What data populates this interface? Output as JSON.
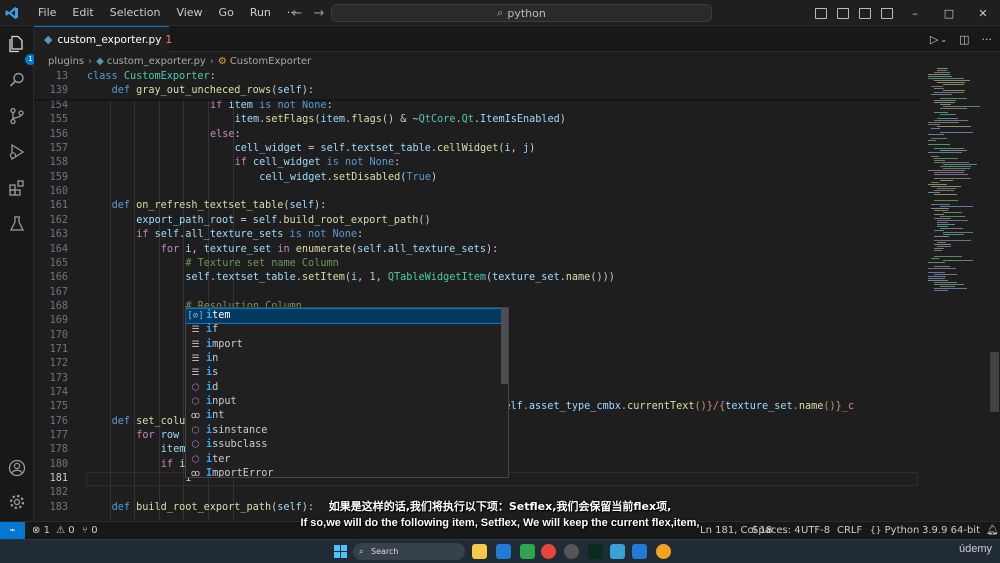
{
  "titlebar": {
    "menu": [
      "File",
      "Edit",
      "Selection",
      "View",
      "Go",
      "Run",
      "···"
    ],
    "search_text": "python",
    "window_controls": [
      "–",
      "□",
      "✕"
    ]
  },
  "activity_bar": {
    "explorer_badge": "1"
  },
  "tab": {
    "label": "custom_exporter.py",
    "problems": "1"
  },
  "breadcrumb": {
    "folder": "plugins",
    "file": "custom_exporter.py",
    "symbol": "CustomExporter"
  },
  "editor": {
    "current_line": "181",
    "sticky": [
      {
        "ln": "13",
        "indent": 0,
        "tokens": [
          [
            "kw",
            "class "
          ],
          [
            "cl",
            "CustomExporter"
          ],
          [
            "",
            ":"
          ]
        ]
      },
      {
        "ln": "139",
        "indent": 1,
        "tokens": [
          [
            "kw",
            "def "
          ],
          [
            "fn",
            "gray_out_uncheced_rows"
          ],
          [
            "",
            "("
          ],
          [
            "sf",
            "self"
          ],
          [
            "",
            "):"
          ]
        ]
      }
    ],
    "lines": [
      {
        "ln": "154",
        "indent": 5,
        "tokens": [
          [
            "kc",
            "if "
          ],
          [
            "sf",
            "item"
          ],
          [
            "kw",
            " is not "
          ],
          [
            "cn",
            "None"
          ],
          [
            "",
            ":"
          ]
        ]
      },
      {
        "ln": "155",
        "indent": 6,
        "tokens": [
          [
            "sf",
            "item"
          ],
          [
            "",
            "."
          ],
          [
            "fn",
            "setFlags"
          ],
          [
            "",
            "("
          ],
          [
            "sf",
            "item"
          ],
          [
            "",
            "."
          ],
          [
            "fn",
            "flags"
          ],
          [
            "",
            "() & ~"
          ],
          [
            "cl",
            "QtCore"
          ],
          [
            "",
            "."
          ],
          [
            "cl",
            "Qt"
          ],
          [
            "",
            "."
          ],
          [
            "sf",
            "ItemIsEnabled"
          ],
          [
            "",
            ")"
          ]
        ]
      },
      {
        "ln": "156",
        "indent": 5,
        "tokens": [
          [
            "kc",
            "else"
          ],
          [
            "",
            ":"
          ]
        ]
      },
      {
        "ln": "157",
        "indent": 6,
        "tokens": [
          [
            "sf",
            "cell_widget"
          ],
          [
            "",
            " = "
          ],
          [
            "sf",
            "self"
          ],
          [
            "",
            "."
          ],
          [
            "sf",
            "textset_table"
          ],
          [
            "",
            "."
          ],
          [
            "fn",
            "cellWidget"
          ],
          [
            "",
            "("
          ],
          [
            "sf",
            "i"
          ],
          [
            "",
            ", "
          ],
          [
            "sf",
            "j"
          ],
          [
            "",
            ")"
          ]
        ]
      },
      {
        "ln": "158",
        "indent": 6,
        "tokens": [
          [
            "kc",
            "if "
          ],
          [
            "sf",
            "cell_widget"
          ],
          [
            "kw",
            " is not "
          ],
          [
            "cn",
            "None"
          ],
          [
            "",
            ":"
          ]
        ]
      },
      {
        "ln": "159",
        "indent": 7,
        "tokens": [
          [
            "sf",
            "cell_widget"
          ],
          [
            "",
            "."
          ],
          [
            "fn",
            "setDisabled"
          ],
          [
            "",
            "("
          ],
          [
            "cn",
            "True"
          ],
          [
            "",
            ")"
          ]
        ]
      },
      {
        "ln": "160",
        "indent": 0,
        "tokens": []
      },
      {
        "ln": "161",
        "indent": 1,
        "tokens": [
          [
            "kw",
            "def "
          ],
          [
            "fn",
            "on_refresh_textset_table"
          ],
          [
            "",
            "("
          ],
          [
            "sf",
            "self"
          ],
          [
            "",
            "):"
          ]
        ]
      },
      {
        "ln": "162",
        "indent": 2,
        "tokens": [
          [
            "sf",
            "export_path_root"
          ],
          [
            "",
            " = "
          ],
          [
            "sf",
            "self"
          ],
          [
            "",
            "."
          ],
          [
            "fn",
            "build_root_export_path"
          ],
          [
            "",
            "()"
          ]
        ]
      },
      {
        "ln": "163",
        "indent": 2,
        "tokens": [
          [
            "kc",
            "if "
          ],
          [
            "sf",
            "self"
          ],
          [
            "",
            "."
          ],
          [
            "sf",
            "all_texture_sets"
          ],
          [
            "kw",
            " is not "
          ],
          [
            "cn",
            "None"
          ],
          [
            "",
            ":"
          ]
        ]
      },
      {
        "ln": "164",
        "indent": 3,
        "tokens": [
          [
            "kc",
            "for "
          ],
          [
            "sf",
            "i"
          ],
          [
            "",
            ", "
          ],
          [
            "sf",
            "texture_set"
          ],
          [
            "kc",
            " in "
          ],
          [
            "fn",
            "enumerate"
          ],
          [
            "",
            "("
          ],
          [
            "sf",
            "self"
          ],
          [
            "",
            "."
          ],
          [
            "sf",
            "all_texture_sets"
          ],
          [
            "",
            "):"
          ]
        ]
      },
      {
        "ln": "165",
        "indent": 4,
        "tokens": [
          [
            "cm",
            "# Texture set name Column"
          ]
        ]
      },
      {
        "ln": "166",
        "indent": 4,
        "tokens": [
          [
            "sf",
            "self"
          ],
          [
            "",
            "."
          ],
          [
            "sf",
            "textset_table"
          ],
          [
            "",
            "."
          ],
          [
            "fn",
            "setItem"
          ],
          [
            "",
            "("
          ],
          [
            "sf",
            "i"
          ],
          [
            "",
            ", "
          ],
          [
            "nm",
            "1"
          ],
          [
            "",
            ", "
          ],
          [
            "cl",
            "QTableWidgetItem"
          ],
          [
            "",
            "("
          ],
          [
            "sf",
            "texture_set"
          ],
          [
            "",
            "."
          ],
          [
            "fn",
            "name"
          ],
          [
            "",
            "()))"
          ]
        ]
      },
      {
        "ln": "167",
        "indent": 0,
        "tokens": []
      },
      {
        "ln": "168",
        "indent": 4,
        "tokens": [
          [
            "cm",
            "# Resolution Column"
          ]
        ]
      },
      {
        "ln": "169",
        "indent": 4,
        "tokens": [
          [
            "sf",
            "r"
          ]
        ]
      },
      {
        "ln": "170",
        "indent": 4,
        "tokens": [
          [
            "sf",
            "w"
          ]
        ]
      },
      {
        "ln": "171",
        "indent": 4,
        "tokens": [
          [
            "sf",
            "h"
          ]
        ]
      },
      {
        "ln": "172",
        "indent": 4,
        "tokens": [
          [
            "sf",
            "s"
          ],
          [
            "",
            "                                   "
          ],
          [
            "sf",
            "h"
          ],
          [
            "st",
            "} x {"
          ],
          [
            "sf",
            "height"
          ],
          [
            "st",
            "}\""
          ],
          [
            "",
            "))"
          ]
        ]
      },
      {
        "ln": "173",
        "indent": 0,
        "tokens": []
      },
      {
        "ln": "174",
        "indent": 4,
        "tokens": [
          [
            "cm",
            "#"
          ]
        ]
      },
      {
        "ln": "175",
        "indent": 4,
        "tokens": [
          [
            "sf",
            "s"
          ],
          [
            "",
            "                                   "
          ],
          [
            "st",
            "rt_path_root"
          ],
          [
            "st",
            "}/{"
          ],
          [
            "sf",
            "self"
          ],
          [
            "st",
            "."
          ],
          [
            "sf",
            "asset_type_cmbx"
          ],
          [
            "st",
            "."
          ],
          [
            "fn",
            "currentText"
          ],
          [
            "st",
            "()}/{"
          ],
          [
            "sf",
            "texture_set"
          ],
          [
            "st",
            "."
          ],
          [
            "fn",
            "name"
          ],
          [
            "st",
            "()}_c"
          ]
        ]
      },
      {
        "ln": "176",
        "indent": 1,
        "tokens": [
          [
            "kw",
            "def "
          ],
          [
            "fn",
            "set_colum"
          ]
        ]
      },
      {
        "ln": "177",
        "indent": 2,
        "tokens": [
          [
            "kc",
            "for "
          ],
          [
            "sf",
            "row i"
          ]
        ]
      },
      {
        "ln": "178",
        "indent": 3,
        "tokens": [
          [
            "sf",
            "item"
          ]
        ]
      },
      {
        "ln": "180",
        "indent": 3,
        "tokens": [
          [
            "kc",
            "if "
          ],
          [
            "sf",
            "it"
          ]
        ]
      },
      {
        "ln": "181",
        "indent": 4,
        "tokens": [
          [
            "sf",
            "i"
          ]
        ]
      },
      {
        "ln": "182",
        "indent": 0,
        "tokens": []
      },
      {
        "ln": "183",
        "indent": 1,
        "tokens": [
          [
            "kw",
            "def "
          ],
          [
            "fn",
            "build_root_export_path"
          ],
          [
            "",
            "("
          ],
          [
            "sf",
            "self"
          ],
          [
            "",
            "):"
          ]
        ]
      }
    ]
  },
  "suggest": {
    "items": [
      {
        "kind": "var",
        "prefix": "i",
        "rest": "tem"
      },
      {
        "kind": "kwd",
        "prefix": "i",
        "rest": "f"
      },
      {
        "kind": "kwd",
        "prefix": "i",
        "rest": "mport"
      },
      {
        "kind": "kwd",
        "prefix": "i",
        "rest": "n"
      },
      {
        "kind": "kwd",
        "prefix": "i",
        "rest": "s"
      },
      {
        "kind": "fn",
        "prefix": "i",
        "rest": "d"
      },
      {
        "kind": "fn",
        "prefix": "i",
        "rest": "nput"
      },
      {
        "kind": "cls",
        "prefix": "i",
        "rest": "nt"
      },
      {
        "kind": "fn",
        "prefix": "i",
        "rest": "sinstance"
      },
      {
        "kind": "fn",
        "prefix": "i",
        "rest": "ssubclass"
      },
      {
        "kind": "fn",
        "prefix": "i",
        "rest": "ter"
      },
      {
        "kind": "cls",
        "prefix": "I",
        "rest": "mportError"
      }
    ]
  },
  "statusbar": {
    "remote": "⌁",
    "errors": "1",
    "warnings": "0",
    "ports": "0",
    "position": "Ln 181, Col 18",
    "spaces": "Spaces: 4",
    "encoding": "UTF-8",
    "eol": "CRLF",
    "language": "Python",
    "interpreter": "3.9.9 64-bit"
  },
  "subtitles": {
    "zh": "如果是这样的话,我们将执行以下项：Setflex,我们会保留当前flex项,",
    "en": "If so,we will do the following item, Setflex, We will keep the current flex,item,"
  },
  "taskbar": {
    "search_label": "Search",
    "watermark": "údemy"
  },
  "colors": {
    "accent": "#0078d4",
    "editor_bg": "#1e1e1e",
    "keyword": "#569cd6",
    "control": "#c586c0",
    "function": "#dcdcaa",
    "class": "#4ec9b0",
    "variable": "#9cdcfe",
    "comment": "#6a9955"
  }
}
